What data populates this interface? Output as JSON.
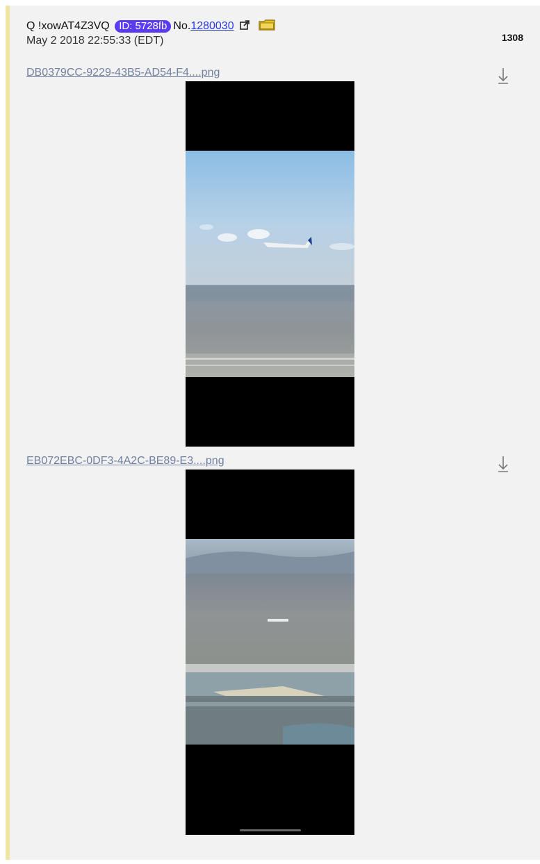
{
  "post": {
    "author": "Q !xowAT4Z3VQ",
    "id_badge": "ID: 5728fb",
    "no_prefix": "No.",
    "no_number": "1280030",
    "date": "May 2 2018 22:55:33 (EDT)",
    "count": "1308",
    "icons": {
      "external": "external-link-icon",
      "folder": "folder-icon",
      "download": "download-arrow-icon"
    },
    "colors": {
      "id_badge": "#5b3bf0",
      "link": "#2a3bd8",
      "folder": "#e7c12a",
      "accent_border": "#efe6a3"
    },
    "files": [
      {
        "filename": "DB0379CC-9229-43B5-AD54-F4....png"
      },
      {
        "filename": "EB072EBC-0DF3-4A2C-BE89-E3....png"
      }
    ]
  }
}
